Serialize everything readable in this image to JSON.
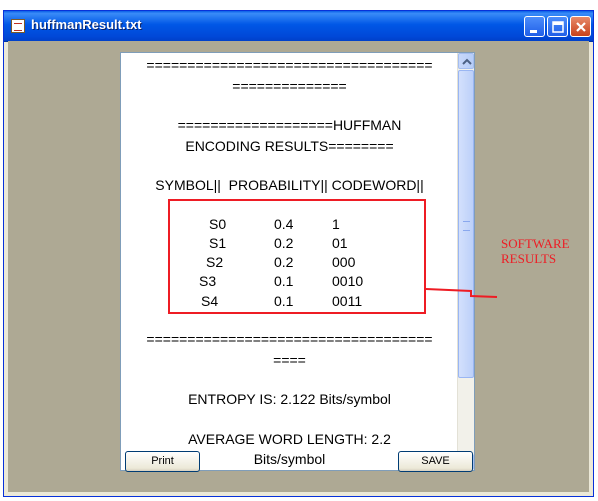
{
  "window": {
    "title": "huffmanResult.txt"
  },
  "text": {
    "lines": [
      "===================================",
      "==============",
      "===================HUFFMAN",
      "ENCODING RESULTS========",
      "SYMBOL||  PROBABILITY|| CODEWORD||"
    ],
    "table": [
      {
        "symbol": "S0",
        "probability": "0.4",
        "codeword": "1"
      },
      {
        "symbol": "S1",
        "probability": "0.2",
        "codeword": "01"
      },
      {
        "symbol": "S2",
        "probability": "0.2",
        "codeword": "000"
      },
      {
        "symbol": "S3",
        "probability": "0.1",
        "codeword": "0010"
      },
      {
        "symbol": "S4",
        "probability": "0.1",
        "codeword": "0011"
      }
    ],
    "separator_a": "===================================",
    "separator_b": "====",
    "entropy": "ENTROPY IS: 2.122 Bits/symbol",
    "avg_len_a": "AVERAGE WORD LENGTH: 2.2",
    "avg_len_b": "Bits/symbol"
  },
  "buttons": {
    "print": "Print",
    "save": "SAVE"
  },
  "annotation": {
    "label": "SOFTWARE RESULTS",
    "color": "#ee1c24"
  },
  "icons": {
    "app": "document-icon",
    "minimize": "minimize-icon",
    "maximize": "maximize-icon",
    "close": "close-icon"
  }
}
